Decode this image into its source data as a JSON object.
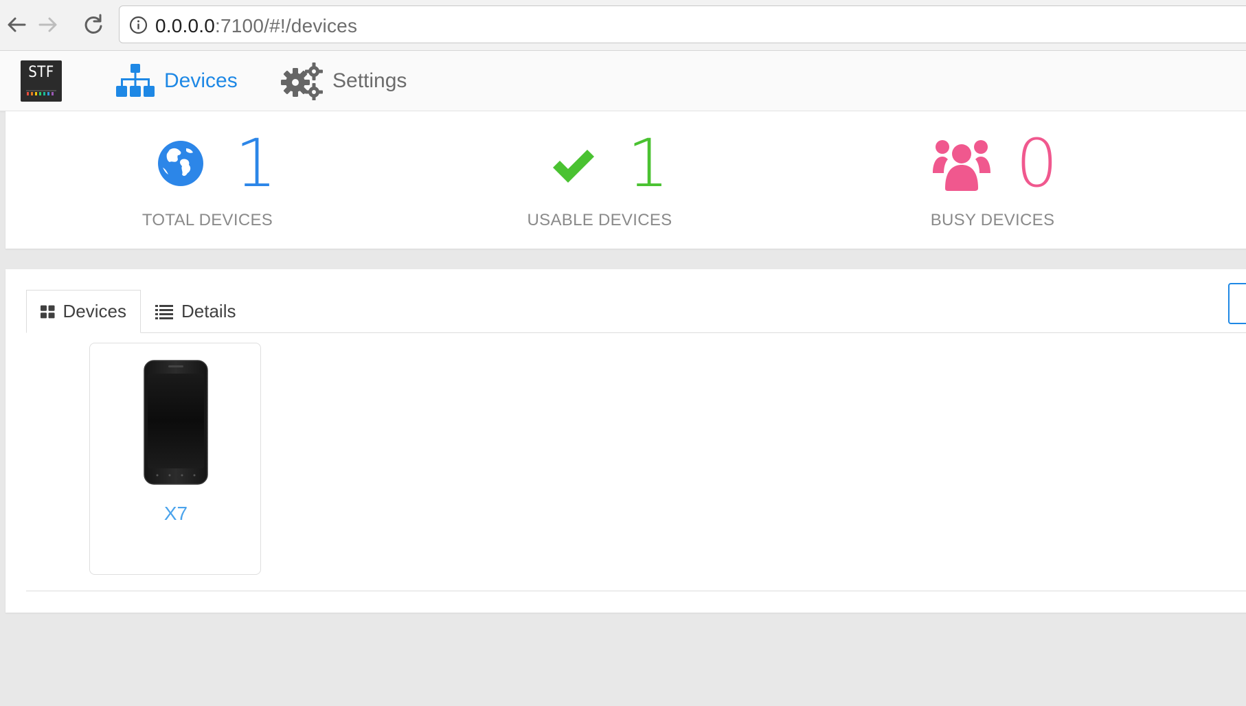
{
  "browser": {
    "url_host": "0.0.0.0",
    "url_path": ":7100/#!/devices"
  },
  "app": {
    "logo_text": "STF",
    "nav": {
      "devices_label": "Devices",
      "settings_label": "Settings"
    }
  },
  "stats": {
    "total": {
      "value": "1",
      "label": "TOTAL DEVICES",
      "color": "#2c86e8",
      "icon": "globe-icon"
    },
    "usable": {
      "value": "1",
      "label": "USABLE DEVICES",
      "color": "#4ac231",
      "icon": "checkmark-icon"
    },
    "busy": {
      "value": "0",
      "label": "BUSY DEVICES",
      "color": "#f0588e",
      "icon": "users-icon"
    }
  },
  "list": {
    "tabs": [
      {
        "label": "Devices",
        "icon": "grid-icon",
        "active": true
      },
      {
        "label": "Details",
        "icon": "list-icon",
        "active": false
      }
    ],
    "devices": [
      {
        "name": "X7",
        "icon": "phone-icon"
      }
    ]
  }
}
